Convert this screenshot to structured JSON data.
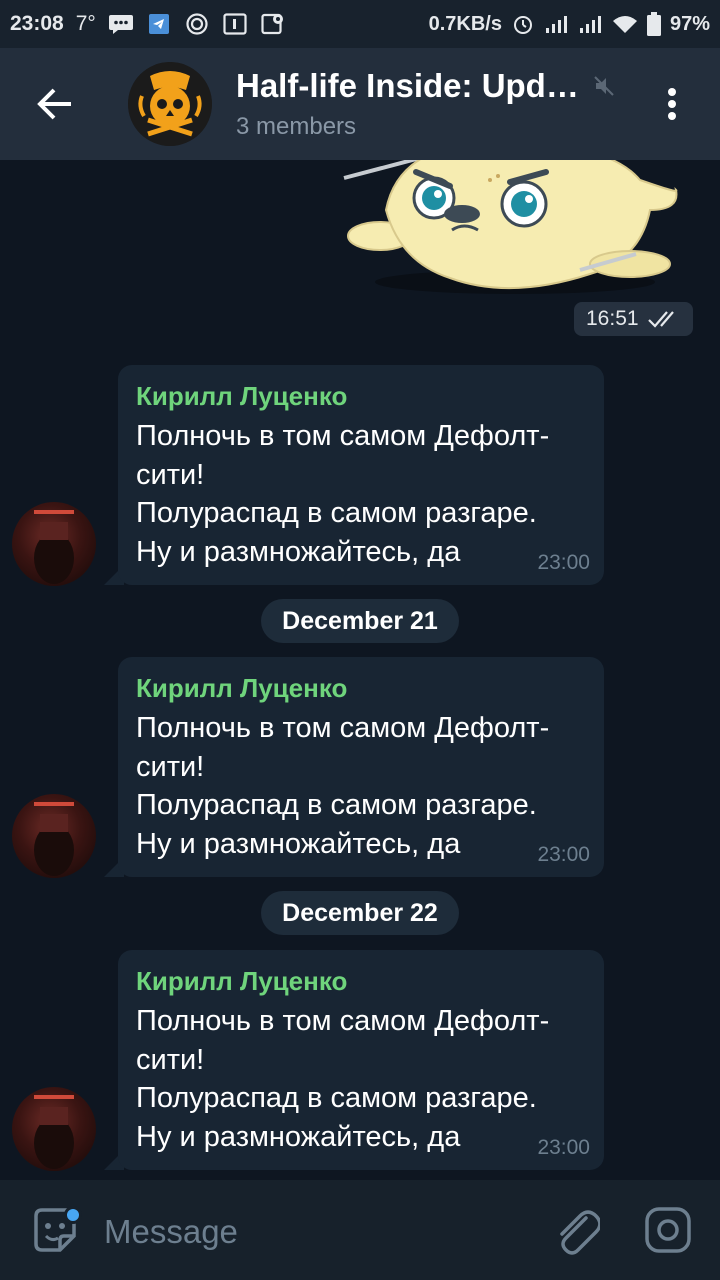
{
  "status_bar": {
    "time": "23:08",
    "temperature": "7°",
    "net_speed": "0.7KB/s",
    "battery": "97%",
    "icons": [
      "chat-icon",
      "telegram-icon",
      "ubisoft-icon",
      "calendar-icon",
      "maps-icon",
      "alarm-icon",
      "signal-icon",
      "signal-icon",
      "wifi-icon",
      "battery-icon"
    ]
  },
  "header": {
    "title": "Half-life Inside: Upd…",
    "subtitle": "3 members",
    "muted_icon": "mute-icon",
    "avatar_icon": "skull-icon"
  },
  "sticker_message": {
    "time": "16:51",
    "status_icon": "double-check-icon"
  },
  "date_separators": [
    "December 21",
    "December 22"
  ],
  "messages": [
    {
      "sender": "Кирилл Луценко",
      "lines": [
        "Полночь в том самом Дефолт-",
        "сити!",
        "Полураспад в самом разгаре.",
        "Ну и размножайтесь, да"
      ],
      "time": "23:00"
    },
    {
      "sender": "Кирилл Луценко",
      "lines": [
        "Полночь в том самом Дефолт-",
        "сити!",
        "Полураспад в самом разгаре.",
        "Ну и размножайтесь, да"
      ],
      "time": "23:00"
    },
    {
      "sender": "Кирилл Луценко",
      "lines": [
        "Полночь в том самом Дефолт-",
        "сити!",
        "Полураспад в самом разгаре.",
        "Ну и размножайтесь, да"
      ],
      "time": "23:00"
    }
  ],
  "input": {
    "placeholder": "Message"
  },
  "colors": {
    "chat_bg": "#0e1621",
    "header_bg": "#232e3c",
    "bubble_bg": "#182533",
    "sender_name": "#6fd47c",
    "accent": "#48a6f2"
  }
}
